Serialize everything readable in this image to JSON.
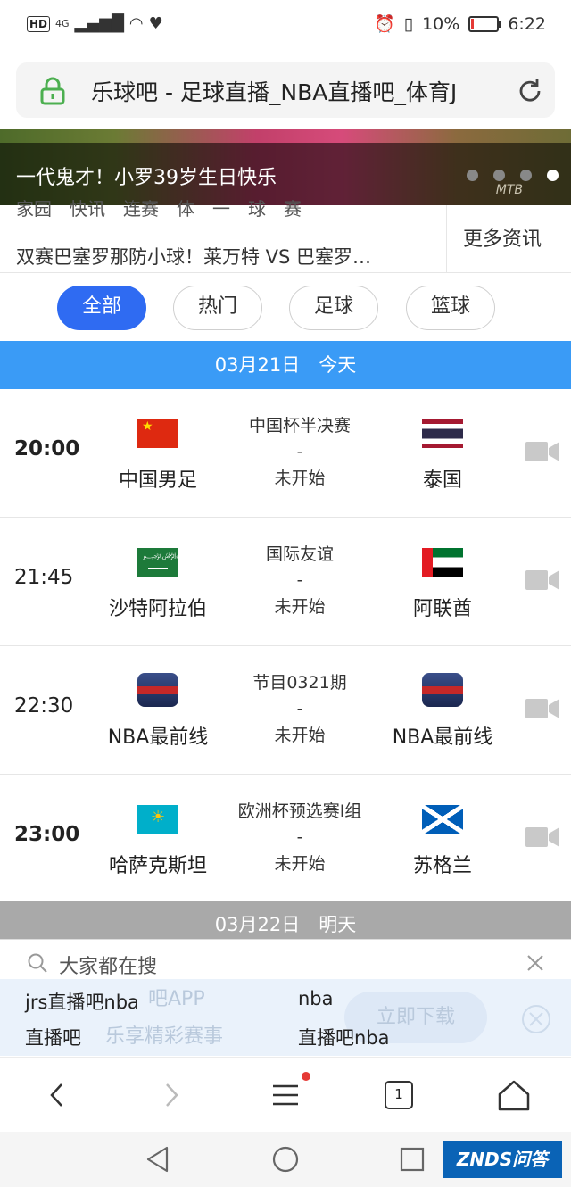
{
  "status_bar": {
    "hd": "HD",
    "net": "4G",
    "battery_text": "10%",
    "battery_level": 0.1,
    "time": "6:22"
  },
  "url_bar": {
    "title": "乐球吧 - 足球直播_NBA直播吧_体育J"
  },
  "banner": {
    "headline": "一代鬼才！小罗39岁生日快乐",
    "watermark": "MTB",
    "slide_count": 4,
    "active_slide": 4
  },
  "news": {
    "partial_line": "家园　快讯　连赛　体　一　球　赛",
    "line": "双赛巴塞罗那防小球！莱万特 VS 巴塞罗…",
    "more_label": "更多资讯"
  },
  "tabs": [
    {
      "label": "全部",
      "active": true
    },
    {
      "label": "热门",
      "active": false
    },
    {
      "label": "足球",
      "active": false
    },
    {
      "label": "篮球",
      "active": false
    }
  ],
  "dates": {
    "today": "03月21日　今天",
    "tomorrow": "03月22日　明天"
  },
  "matches": [
    {
      "time": "20:00",
      "bold": true,
      "event": "中国杯半决赛",
      "dash": "-",
      "status": "未开始",
      "home": "中国男足",
      "home_flag": "china-flag-icon",
      "away": "泰国",
      "away_flag": "thailand-flag-icon"
    },
    {
      "time": "21:45",
      "bold": false,
      "event": "国际友谊",
      "dash": "-",
      "status": "未开始",
      "home": "沙特阿拉伯",
      "home_flag": "saudi-arabia-flag-icon",
      "away": "阿联酋",
      "away_flag": "uae-flag-icon"
    },
    {
      "time": "22:30",
      "bold": false,
      "event": "节目0321期",
      "dash": "-",
      "status": "未开始",
      "home": "NBA最前线",
      "home_flag": "nba-show-logo-icon",
      "away": "NBA最前线",
      "away_flag": "nba-show-logo-icon"
    },
    {
      "time": "23:00",
      "bold": true,
      "event": "欧洲杯预选赛I组",
      "dash": "-",
      "status": "未开始",
      "home": "哈萨克斯坦",
      "home_flag": "kazakhstan-flag-icon",
      "away": "苏格兰",
      "away_flag": "scotland-flag-icon"
    }
  ],
  "suggest": {
    "title": "大家都在搜",
    "items": [
      "jrs直播吧nba",
      "nba",
      "直播吧",
      "直播吧nba"
    ],
    "ad_ghost_1": "吧APP",
    "ad_ghost_2": "乐享精彩赛事",
    "ad_button": "立即下载"
  },
  "browser_nav": {
    "tab_count": "1"
  },
  "watermark": {
    "text": "ZNDS问答"
  },
  "colors": {
    "accent_blue": "#2f6bf2",
    "date_today": "#3a9bf6",
    "date_tomorrow": "#a9a9a9",
    "lock_green": "#4caf50"
  }
}
